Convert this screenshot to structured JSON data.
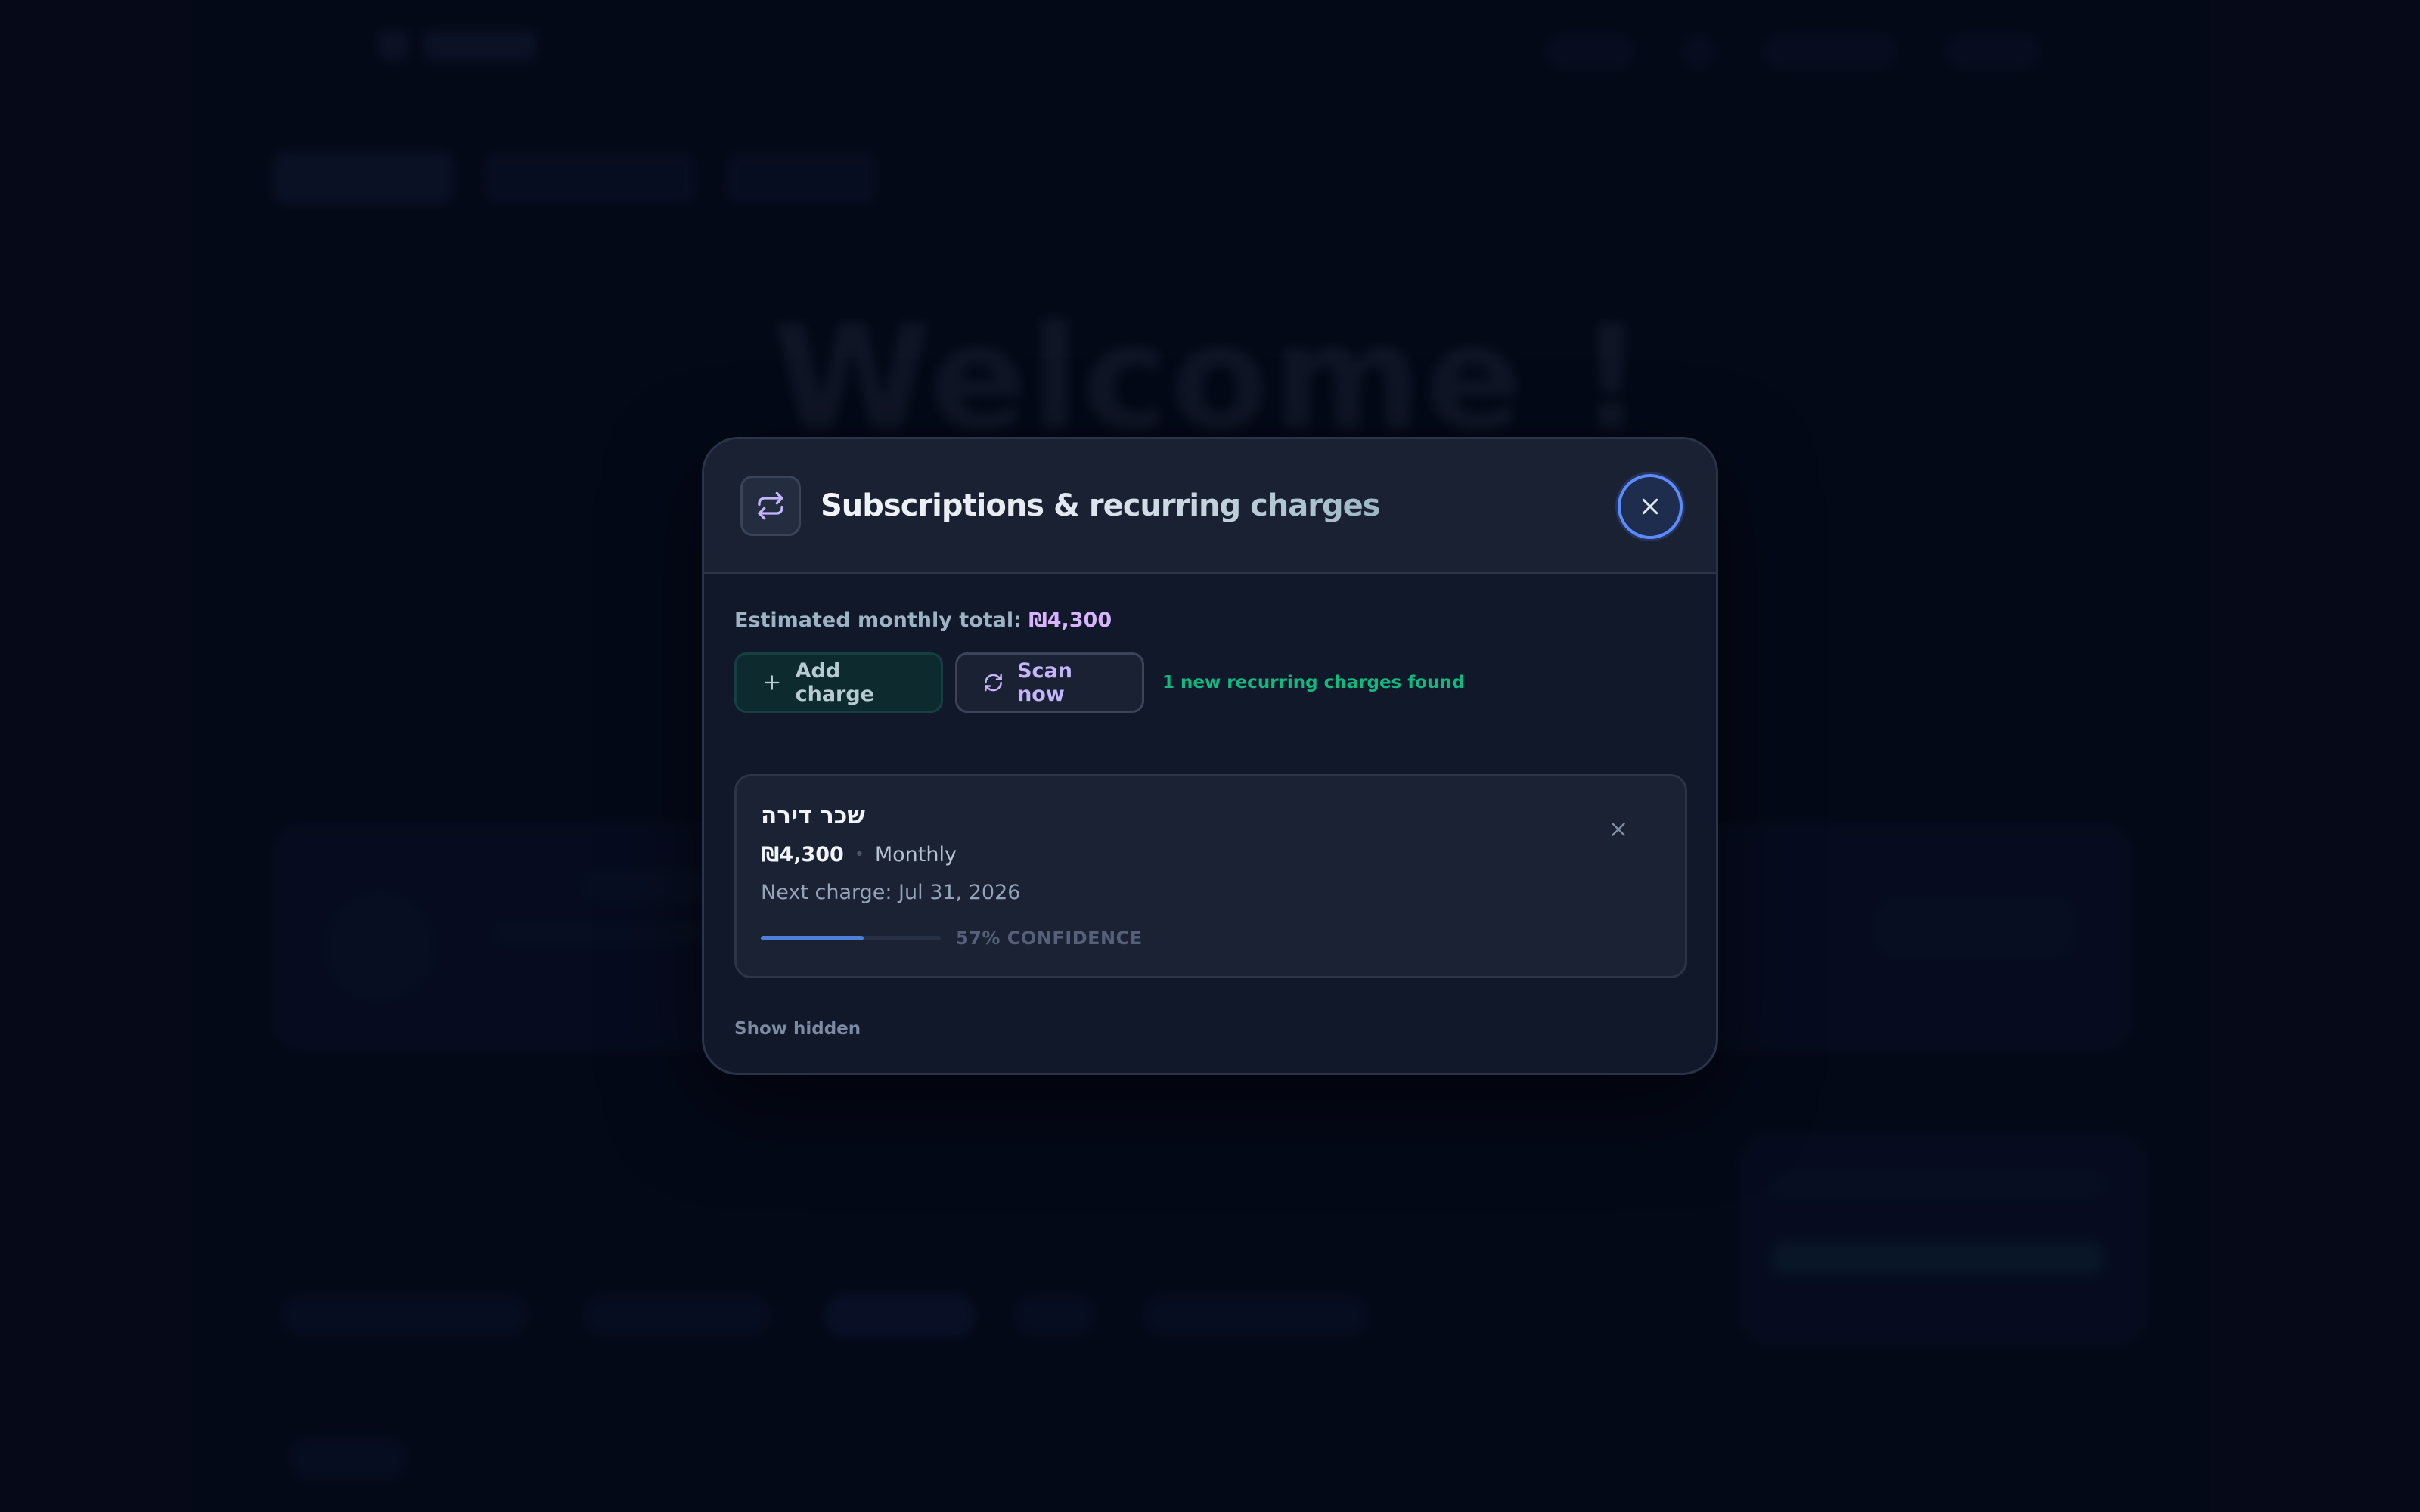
{
  "background": {
    "welcome_text": "Welcome !"
  },
  "modal": {
    "header_icon": "repeat-icon",
    "title": "Subscriptions & recurring charges",
    "close_icon": "close-icon",
    "total_label": "Estimated monthly total:",
    "total_value": "₪4,300",
    "add_button_icon": "plus-icon",
    "add_button_label": "Add charge",
    "scan_button_icon": "refresh-icon",
    "scan_button_label": "Scan now",
    "found_note": "1 new recurring charges found",
    "charges": [
      {
        "name": "שכר דירה",
        "amount": "₪4,300",
        "separator": "•",
        "frequency": "Monthly",
        "next_charge": "Next charge: Jul 31, 2026",
        "confidence": 0.57,
        "confidence_label": "57% CONFIDENCE",
        "dismiss_icon": "close-icon"
      }
    ],
    "show_hidden_label": "Show hidden"
  },
  "colors": {
    "accent_purple": "#d8b4fe",
    "accent_green": "#10b981",
    "focus_blue": "#5b8cff",
    "confidence_bar": "#4f7fd6"
  }
}
